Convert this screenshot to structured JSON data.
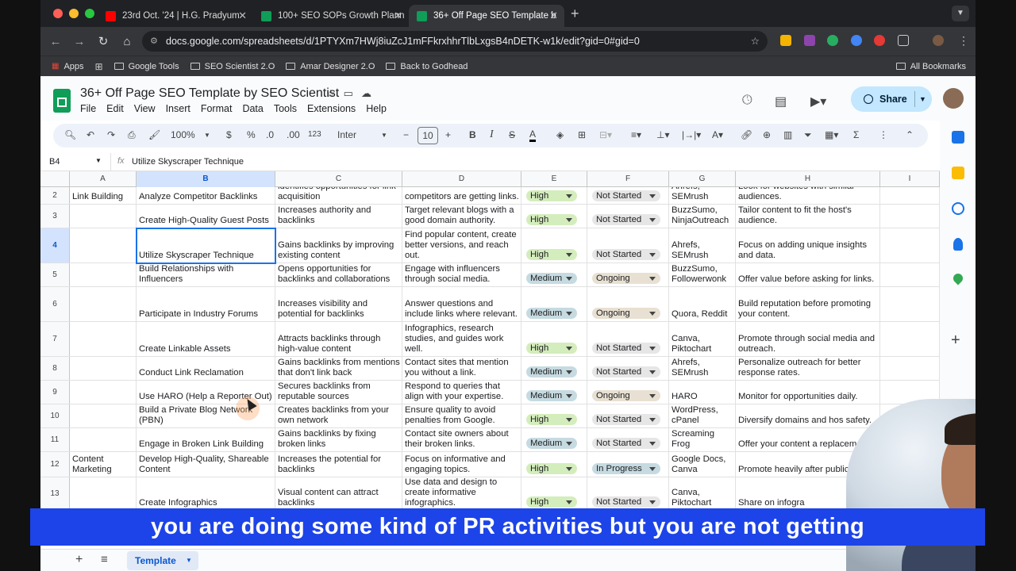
{
  "browser": {
    "tabs": [
      {
        "title": "23rd Oct. '24 | H.G. Pradyum",
        "icon": "youtube-icon",
        "color": "#ff0000"
      },
      {
        "title": "100+ SEO SOPs Growth Plann",
        "icon": "sheets-icon",
        "color": "#0f9d58"
      },
      {
        "title": "36+ Off Page SEO Template b",
        "icon": "sheets-icon",
        "color": "#0f9d58"
      }
    ],
    "url": "docs.google.com/spreadsheets/d/1PTYXm7HWj8iuZcJ1mFFkrxhhrTlbLxgsB4nDETK-w1k/edit?gid=0#gid=0",
    "bookmarks": [
      "Apps",
      "Google Tools",
      "SEO Scientist 2.O",
      "Amar Designer 2.O",
      "Back to Godhead"
    ],
    "all_bookmarks": "All Bookmarks"
  },
  "doc": {
    "title": "36+ Off Page SEO Template by SEO Scientist",
    "menus": [
      "File",
      "Edit",
      "View",
      "Insert",
      "Format",
      "Data",
      "Tools",
      "Extensions",
      "Help"
    ],
    "share": "Share"
  },
  "toolbar": {
    "zoom": "100%",
    "currency": "$",
    "percent": "%",
    "dec_less": ".0",
    "dec_more": ".00",
    "format": "123",
    "font": "Inter",
    "font_size": "10"
  },
  "formula": {
    "cellref": "B4",
    "fx": "fx",
    "content": "Utilize Skyscraper Technique"
  },
  "columns": [
    "A",
    "B",
    "C",
    "D",
    "E",
    "F",
    "G",
    "H",
    "I"
  ],
  "rows": [
    {
      "n": "2",
      "a": "Link Building",
      "b": "Analyze Competitor Backlinks",
      "c": "identifies opportunities for link acquisition",
      "d": "competitors are getting links.",
      "e": "High",
      "f": "Not Started",
      "g": "Ahrefs, SEMrush",
      "h": "Look for websites with similar audiences."
    },
    {
      "n": "3",
      "a": "",
      "b": "Create High-Quality Guest Posts",
      "c": "Increases authority and backlinks",
      "d": "Target relevant blogs with a good domain authority.",
      "e": "High",
      "f": "Not Started",
      "g": "BuzzSumo, NinjaOutreach",
      "h": "Tailor content to fit the host's audience."
    },
    {
      "n": "4",
      "a": "",
      "b": "Utilize Skyscraper Technique",
      "c": "Gains backlinks by improving existing content",
      "d": "Find popular content, create better versions, and reach out.",
      "e": "High",
      "f": "Not Started",
      "g": "Ahrefs, SEMrush",
      "h": "Focus on adding unique insights and data."
    },
    {
      "n": "5",
      "a": "",
      "b": "Build Relationships with Influencers",
      "c": "Opens opportunities for backlinks and collaborations",
      "d": "Engage with influencers through social media.",
      "e": "Medium",
      "f": "Ongoing",
      "g": "BuzzSumo, Followerwonk",
      "h": "Offer value before asking for links."
    },
    {
      "n": "6",
      "a": "",
      "b": "Participate in Industry Forums",
      "c": "Increases visibility and potential for backlinks",
      "d": "Answer questions and include links where relevant.",
      "e": "Medium",
      "f": "Ongoing",
      "g": "Quora, Reddit",
      "h": "Build reputation before promoting your content."
    },
    {
      "n": "7",
      "a": "",
      "b": "Create Linkable Assets",
      "c": "Attracts backlinks through high-value content",
      "d": "Infographics, research studies, and guides work well.",
      "e": "High",
      "f": "Not Started",
      "g": "Canva, Piktochart",
      "h": "Promote through social media and outreach."
    },
    {
      "n": "8",
      "a": "",
      "b": "Conduct Link Reclamation",
      "c": "Gains backlinks from mentions that don't link back",
      "d": "Contact sites that mention you without a link.",
      "e": "Medium",
      "f": "Not Started",
      "g": "Ahrefs, SEMrush",
      "h": "Personalize outreach for better response rates."
    },
    {
      "n": "9",
      "a": "",
      "b": "Use HARO (Help a Reporter Out)",
      "c": "Secures backlinks from reputable sources",
      "d": "Respond to queries that align with your expertise.",
      "e": "Medium",
      "f": "Ongoing",
      "g": "HARO",
      "h": "Monitor for opportunities daily."
    },
    {
      "n": "10",
      "a": "",
      "b": "Build a Private Blog Network (PBN)",
      "c": "Creates backlinks from your own network",
      "d": "Ensure quality to avoid penalties from Google.",
      "e": "High",
      "f": "Not Started",
      "g": "WordPress, cPanel",
      "h": "Diversify domains and hos safety."
    },
    {
      "n": "11",
      "a": "",
      "b": "Engage in Broken Link Building",
      "c": "Gains backlinks by fixing broken links",
      "d": "Contact site owners about their broken links.",
      "e": "Medium",
      "f": "Not Started",
      "g": "Screaming Frog",
      "h": "Offer your content a replacement."
    },
    {
      "n": "12",
      "a": "Content Marketing",
      "b": "Develop High-Quality, Shareable Content",
      "c": "Increases the potential for backlinks",
      "d": "Focus on informative and engaging topics.",
      "e": "High",
      "f": "In Progress",
      "g": "Google Docs, Canva",
      "h": "Promote heavily after publication"
    },
    {
      "n": "13",
      "a": "",
      "b": "Create Infographics",
      "c": "Visual content can attract backlinks",
      "d": "Use data and design to create informative infographics.",
      "e": "High",
      "f": "Not Started",
      "g": "Canva, Piktochart",
      "h": "Share on infogra"
    }
  ],
  "chip_colors": {
    "High": "#d4edbc",
    "Medium": "#c6dbe1",
    "Not Started": "#e6e6e6",
    "Ongoing": "#e8e0d2",
    "In Progress": "#c6dbe1"
  },
  "sheet_tab": "Template",
  "caption": "you are doing some kind of PR activities but you are not getting"
}
